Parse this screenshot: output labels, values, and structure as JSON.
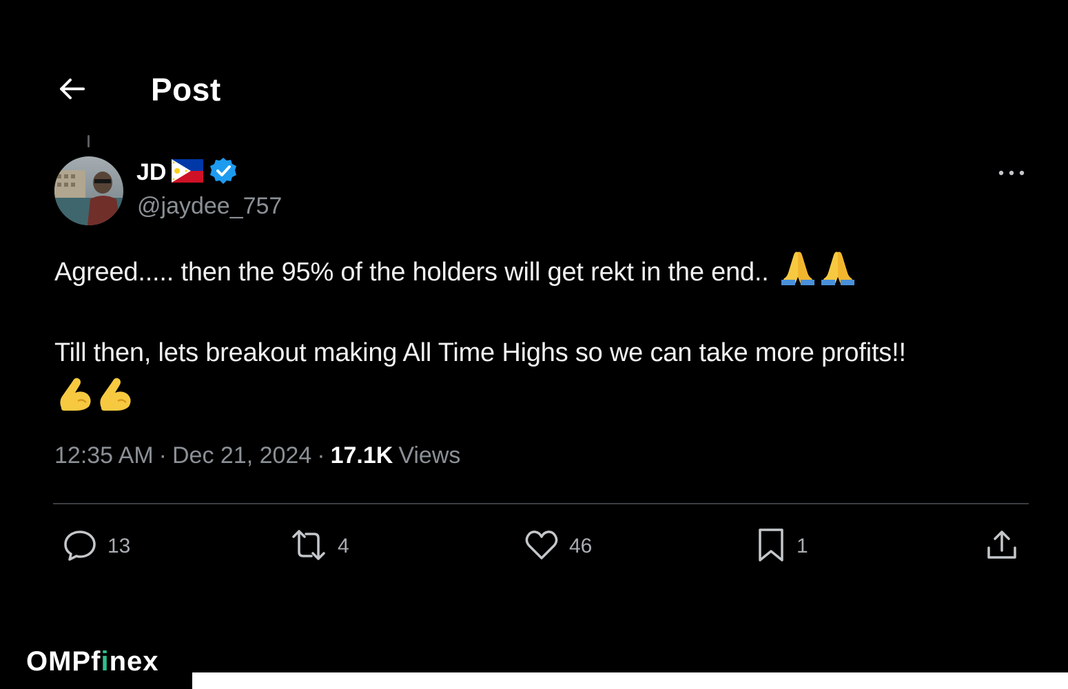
{
  "header": {
    "title": "Post",
    "back_icon": "arrow-left-icon"
  },
  "author": {
    "name": "JD",
    "handle": "@jaydee_757",
    "flag_icon": "philippines-flag-icon",
    "verified_icon": "verified-badge-icon",
    "more_icon": "more-horizontal-icon"
  },
  "tweet": {
    "line1": "Agreed..... then the 95% of the holders will get rekt in the end..",
    "line1_emoji": "🙏🙏",
    "line2": "Till then, lets breakout making All Time Highs so we can take more profits!!",
    "line2_emoji": "💪💪"
  },
  "meta": {
    "time": "12:35 AM",
    "separator": "·",
    "date": "Dec 21, 2024",
    "views_count": "17.1K",
    "views_label": "Views"
  },
  "actions": {
    "replies": "13",
    "reposts": "4",
    "likes": "46",
    "bookmarks": "1"
  },
  "watermark": {
    "part1": "OMP",
    "part2": "f",
    "part3": "i",
    "part4": "nex"
  },
  "colors": {
    "background": "#000000",
    "text": "#f2f2f2",
    "muted": "#8b9096",
    "verified": "#1d9bf0",
    "watermark_accent": "#2fbf8f"
  }
}
